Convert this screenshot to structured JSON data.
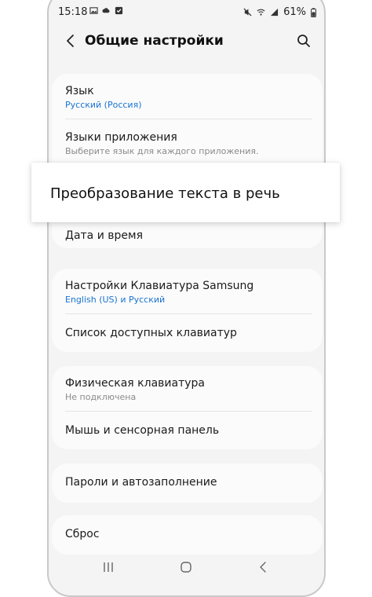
{
  "status_bar": {
    "time": "15:18",
    "battery": "61%",
    "icons_left": [
      "image-icon",
      "cloud-icon",
      "check-box-icon"
    ],
    "icons_right": [
      "mute-icon",
      "wifi-icon",
      "signal-icon",
      "battery-icon"
    ]
  },
  "header": {
    "title": "Общие настройки"
  },
  "settings": {
    "language": {
      "label": "Язык",
      "sub": "Русский (Россия)"
    },
    "app_languages": {
      "label": "Языки приложения",
      "sub": "Выберите язык для каждого приложения."
    },
    "tts": {
      "label": "Преобразование текста в речь"
    },
    "date_time": {
      "label": "Дата и время"
    },
    "samsung_keyboard": {
      "label": "Настройки Клавиатура Samsung",
      "sub": "English (US) и Русский"
    },
    "keyboard_list": {
      "label": "Список доступных клавиатур"
    },
    "physical_keyboard": {
      "label": "Физическая клавиатура",
      "sub": "Не подключена"
    },
    "mouse_touchpad": {
      "label": "Мышь и сенсорная панель"
    },
    "passwords": {
      "label": "Пароли и автозаполнение"
    },
    "reset": {
      "label": "Сброс"
    }
  },
  "colors": {
    "accent": "#1a73d1",
    "background": "#f4f4f4",
    "card": "#fbfbfb"
  }
}
